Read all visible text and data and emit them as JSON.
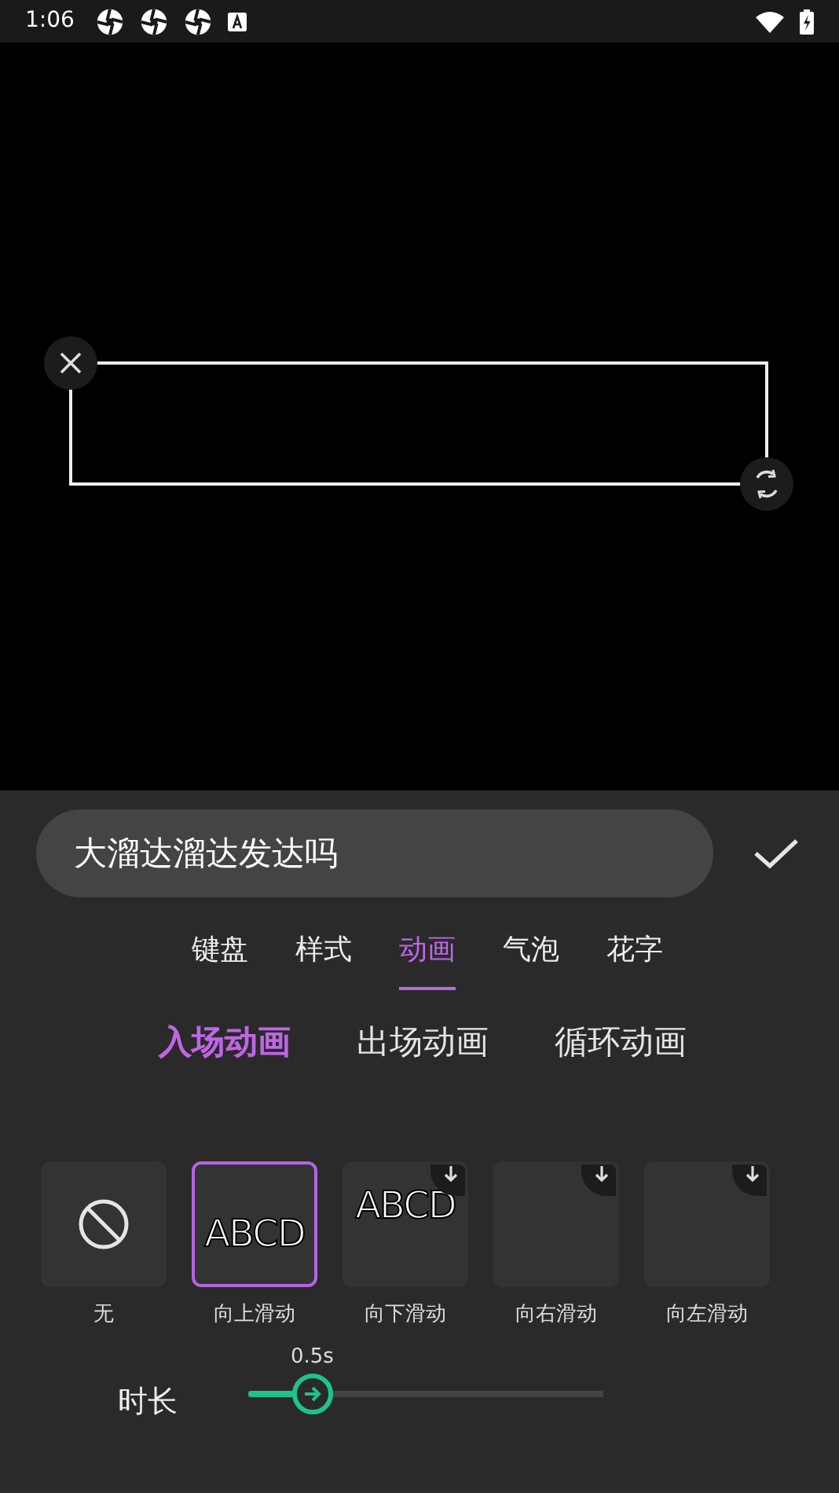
{
  "status_bar": {
    "time": "1:06"
  },
  "text_input": {
    "value": "大溜达溜达发达吗"
  },
  "tabs": [
    {
      "label": "键盘",
      "selected": false
    },
    {
      "label": "样式",
      "selected": false
    },
    {
      "label": "动画",
      "selected": true
    },
    {
      "label": "气泡",
      "selected": false
    },
    {
      "label": "花字",
      "selected": false
    }
  ],
  "sub_tabs": [
    {
      "label": "入场动画",
      "selected": true
    },
    {
      "label": "出场动画",
      "selected": false
    },
    {
      "label": "循环动画",
      "selected": false
    }
  ],
  "animations": [
    {
      "kind": "none",
      "label": "无",
      "selected": false,
      "downloadable": false
    },
    {
      "kind": "text",
      "preview": "ABCD",
      "label": "向上滑动",
      "selected": true,
      "downloadable": false
    },
    {
      "kind": "text",
      "preview": "ABCD",
      "label": "向下滑动",
      "selected": false,
      "downloadable": true
    },
    {
      "kind": "blank",
      "label": "向右滑动",
      "selected": false,
      "downloadable": true
    },
    {
      "kind": "blank",
      "label": "向左滑动",
      "selected": false,
      "downloadable": true
    }
  ],
  "duration": {
    "label": "时长",
    "reading": "0.5s",
    "level": 0.18
  }
}
